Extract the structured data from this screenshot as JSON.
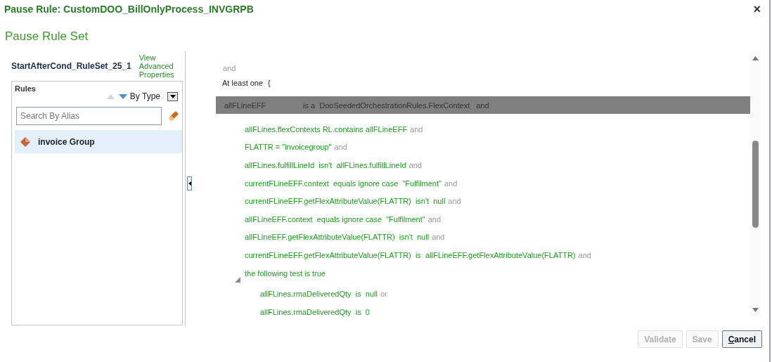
{
  "dialog": {
    "title": "Pause Rule: CustomDOO_BillOnlyProcess_INVGRPB",
    "close": "×"
  },
  "heading": "Pause Rule Set",
  "ruleset": {
    "name": "StartAfterCond_RuleSet_25_1",
    "link": "View Advanced Properties"
  },
  "rules_panel": {
    "title": "Rules",
    "sort_label": "By Type",
    "search": {
      "placeholder": "Search By Alias"
    },
    "items": [
      {
        "label": "invoice Group",
        "selected": true
      }
    ]
  },
  "splitter": {
    "collapsed": false
  },
  "editor": {
    "lead_connector": "and",
    "quantifier": "At least one",
    "brace": "{",
    "fact": {
      "variable": "allFLineEFF",
      "type_clause": "is a  DooSeededOrchestrationRules.FlexContext",
      "connector": "and"
    },
    "conditions": [
      {
        "text": "allFLines.flexContexts RL.contains allFLineEFF",
        "connector": "and"
      },
      {
        "text": "FLATTR = \"invoicegroup\"",
        "connector": "and"
      },
      {
        "text": "allFLines.fulfillLineId  isn't  allFLines.fulfillLineId",
        "connector": "and"
      },
      {
        "text": "currentFLineEFF.context  equals ignore case  \"Fulfilment\"",
        "connector": "and"
      },
      {
        "text": "currentFLineEFF.getFlexAttributeValue(FLATTR)  isn't  null",
        "connector": "and"
      },
      {
        "text": "allFLineEFF.context  equals ignore case  \"Fulfilment\"",
        "connector": "and"
      },
      {
        "text": "allFLineEFF.getFlexAttributeValue(FLATTR)  isn't  null",
        "connector": "and"
      },
      {
        "text": "currentFLineEFF.getFlexAttributeValue(FLATTR)  is  allFLineEFF.getFlexAttributeValue(FLATTR)",
        "connector": "and"
      },
      {
        "text": "the following test is true",
        "expanded": true,
        "children": [
          {
            "text": "allFLines.rmaDeliveredQty  is  null",
            "connector": "or"
          },
          {
            "text": "allFLines.rmaDeliveredQty  is  0"
          }
        ]
      }
    ]
  },
  "buttons": [
    {
      "label": "Validate",
      "disabled": true
    },
    {
      "label": "Save",
      "disabled": true
    },
    {
      "label": "Cancel",
      "disabled": false
    }
  ]
}
